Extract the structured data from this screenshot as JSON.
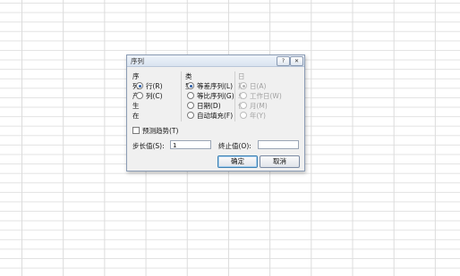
{
  "dialog": {
    "title": "序列",
    "help_label": "?",
    "close_label": "✕",
    "series_in": {
      "label": "序列产生在",
      "options": [
        {
          "label": "行(R)",
          "selected": true
        },
        {
          "label": "列(C)",
          "selected": false
        }
      ]
    },
    "type": {
      "label": "类型",
      "options": [
        {
          "label": "等差序列(L)",
          "selected": true
        },
        {
          "label": "等比序列(G)",
          "selected": false
        },
        {
          "label": "日期(D)",
          "selected": false
        },
        {
          "label": "自动填充(F)",
          "selected": false
        }
      ]
    },
    "date_unit": {
      "label": "日期单位",
      "options": [
        {
          "label": "日(A)",
          "selected": true
        },
        {
          "label": "工作日(W)",
          "selected": false
        },
        {
          "label": "月(M)",
          "selected": false
        },
        {
          "label": "年(Y)",
          "selected": false
        }
      ]
    },
    "trend_label": "预测趋势(T)",
    "step": {
      "label": "步长值(S):",
      "value": "1"
    },
    "stop": {
      "label": "终止值(O):",
      "value": ""
    },
    "ok_label": "确定",
    "cancel_label": "取消"
  }
}
